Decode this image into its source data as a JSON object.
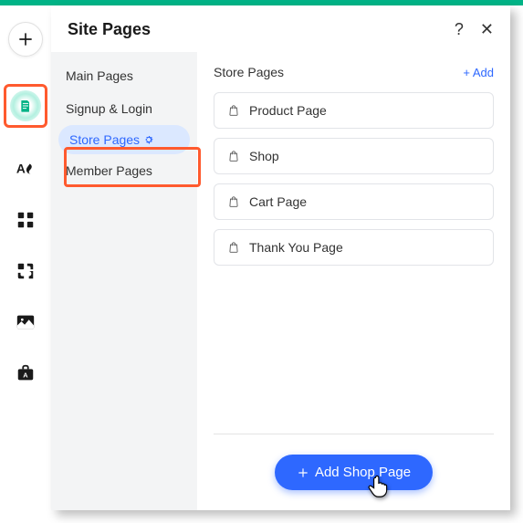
{
  "panel": {
    "title": "Site Pages",
    "help": "?",
    "close": "✕"
  },
  "categories": {
    "items": [
      {
        "label": "Main Pages"
      },
      {
        "label": "Signup & Login"
      },
      {
        "label": "Store Pages"
      },
      {
        "label": "Member Pages"
      }
    ],
    "active_index": 2
  },
  "content": {
    "title": "Store Pages",
    "add_link": "+  Add",
    "pages": [
      {
        "label": "Product Page"
      },
      {
        "label": "Shop"
      },
      {
        "label": "Cart Page"
      },
      {
        "label": "Thank You Page"
      }
    ]
  },
  "footer": {
    "button_label": "Add Shop Page"
  }
}
